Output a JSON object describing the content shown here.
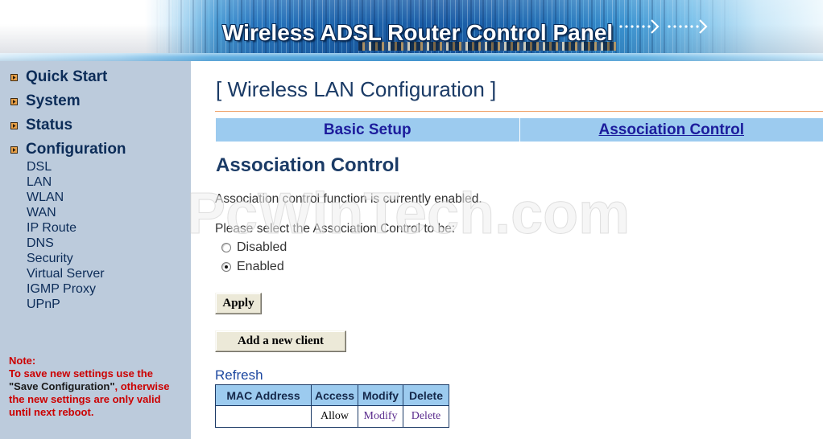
{
  "banner": {
    "title": "Wireless ADSL Router Control Panel"
  },
  "sidebar": {
    "main_items": [
      "Quick Start",
      "System",
      "Status",
      "Configuration"
    ],
    "sub_items": [
      "DSL",
      "LAN",
      "WLAN",
      "WAN",
      "IP Route",
      "DNS",
      "Security",
      "Virtual Server",
      "IGMP Proxy",
      "UPnP"
    ],
    "note": {
      "heading": "Note:",
      "line1": "To save new settings use the",
      "line2_highlight": "\"Save Configuration\"",
      "line2_rest": ", otherwise",
      "line3": "the new settings are only valid",
      "line4": "until next reboot."
    }
  },
  "main": {
    "page_title": "[ Wireless LAN Configuration ]",
    "tabs": [
      {
        "label": "Basic Setup",
        "active": false
      },
      {
        "label": "Association Control",
        "active": true
      }
    ],
    "section_title": "Association Control",
    "status_text": "Association control function is currently enabled.",
    "prompt_text": "Please select the Association Control to be:",
    "options": [
      {
        "label": "Disabled",
        "checked": false
      },
      {
        "label": "Enabled",
        "checked": true
      }
    ],
    "apply_label": "Apply",
    "add_client_label": "Add a new client",
    "refresh_label": "Refresh",
    "client_table": {
      "headers": [
        "MAC Address",
        "Access",
        "Modify",
        "Delete"
      ],
      "rows": [
        {
          "access": "Allow",
          "modify": "Modify",
          "delete": "Delete"
        }
      ]
    }
  },
  "watermark": {
    "text": "PcWinTech.com"
  },
  "icons": {
    "nav_bullet": "bullet-arrow-icon",
    "banner_arrows": "dotted-arrow-icon"
  },
  "colors": {
    "sidebar_bg": "#bccbdc",
    "nav_text": "#0c2c58",
    "accent": "#9ccbef",
    "note_red": "#cc0000",
    "rule": "#f0a46c",
    "tab_text": "#1c1c9c",
    "heading": "#1b3b66",
    "body_text": "#343434",
    "link": "#1d48a0",
    "visited": "#5b2c8e",
    "table_border": "#1c3a66"
  }
}
